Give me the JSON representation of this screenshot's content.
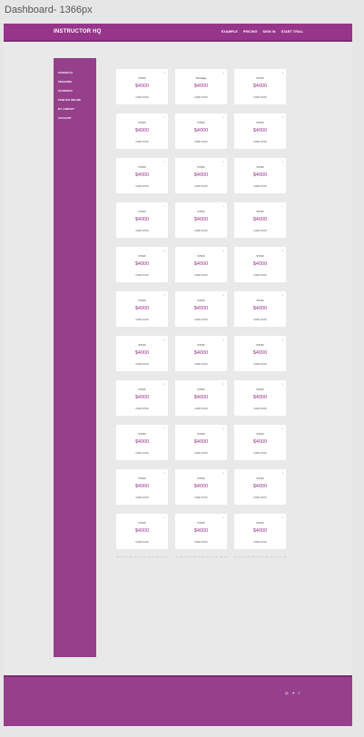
{
  "frame_title": "Dashboard- 1366px",
  "header": {
    "brand": "INSTRUCTOR HQ",
    "nav": [
      "EXAMPLE",
      "PRICING",
      "SIGN IN",
      "START TRIAL"
    ]
  },
  "sidebar": {
    "items": [
      "SCHEDULE",
      "SESSIONS",
      "STUDENTS",
      "PUBLISH ONLINE",
      "MY LIBRARY",
      "ACCOUNT"
    ]
  },
  "main": {
    "section_label": "",
    "cards": [
      {
        "title": "STUD",
        "price": "$4000",
        "foot": "CARD FOOD"
      },
      {
        "title": "Package",
        "price": "$4000",
        "foot": "CARD FOOD"
      },
      {
        "title": "STUD",
        "price": "$4000",
        "foot": "CARD FOOD"
      },
      {
        "title": "STUD",
        "price": "$4000",
        "foot": "CARD FOOD"
      },
      {
        "title": "STUD",
        "price": "$4000",
        "foot": "CARD FOOD"
      },
      {
        "title": "STUD",
        "price": "$4000",
        "foot": "CARD FOOD"
      },
      {
        "title": "STUD",
        "price": "$4000",
        "foot": "CARD FOOD"
      },
      {
        "title": "STUD",
        "price": "$4000",
        "foot": "CARD FOOD"
      },
      {
        "title": "STUD",
        "price": "$4000",
        "foot": "CARD FOOD"
      },
      {
        "title": "STUD",
        "price": "$4000",
        "foot": "CARD FOOD"
      },
      {
        "title": "STUD",
        "price": "$4000",
        "foot": "CARD FOOD"
      },
      {
        "title": "STUD",
        "price": "$4000",
        "foot": "CARD FOOD"
      },
      {
        "title": "STUD",
        "price": "$4000",
        "foot": "CARD FOOD"
      },
      {
        "title": "STUD",
        "price": "$4000",
        "foot": "CARD FOOD"
      },
      {
        "title": "STUD",
        "price": "$4000",
        "foot": "CARD FOOD"
      },
      {
        "title": "STUD",
        "price": "$4000",
        "foot": "CARD FOOD"
      },
      {
        "title": "STUD",
        "price": "$4000",
        "foot": "CARD FOOD"
      },
      {
        "title": "STUD",
        "price": "$4000",
        "foot": "CARD FOOD"
      },
      {
        "title": "STUD",
        "price": "$4000",
        "foot": "CARD FOOD"
      },
      {
        "title": "STUD",
        "price": "$4000",
        "foot": "CARD FOOD"
      },
      {
        "title": "STUD",
        "price": "$4000",
        "foot": "CARD FOOD"
      },
      {
        "title": "STUD",
        "price": "$4000",
        "foot": "CARD FOOD"
      },
      {
        "title": "STUD",
        "price": "$4000",
        "foot": "CARD FOOD"
      },
      {
        "title": "STUD",
        "price": "$4000",
        "foot": "CARD FOOD"
      },
      {
        "title": "STUD",
        "price": "$4000",
        "foot": "CARD FOOD"
      },
      {
        "title": "STUD",
        "price": "$4000",
        "foot": "CARD FOOD"
      },
      {
        "title": "STUD",
        "price": "$4000",
        "foot": "CARD FOOD"
      },
      {
        "title": "STUD",
        "price": "$4000",
        "foot": "CARD FOOD"
      },
      {
        "title": "STUD",
        "price": "$4000",
        "foot": "CARD FOOD"
      },
      {
        "title": "STUD",
        "price": "$4000",
        "foot": "CARD FOOD"
      },
      {
        "title": "STUD",
        "price": "$4000",
        "foot": "CARD FOOD"
      },
      {
        "title": "STUD",
        "price": "$4000",
        "foot": "CARD FOOD"
      },
      {
        "title": "STUD",
        "price": "$4000",
        "foot": "CARD FOOD"
      }
    ],
    "card_corner_icon": "x"
  },
  "footer": {
    "col1_title": "",
    "col1_links": [],
    "col2_title": "",
    "col2_links": [],
    "social": [
      "ig",
      "tw",
      "fb"
    ]
  },
  "colors": {
    "brand": "#96358a",
    "sidebar": "#96408c",
    "background": "#e9e9ea"
  }
}
